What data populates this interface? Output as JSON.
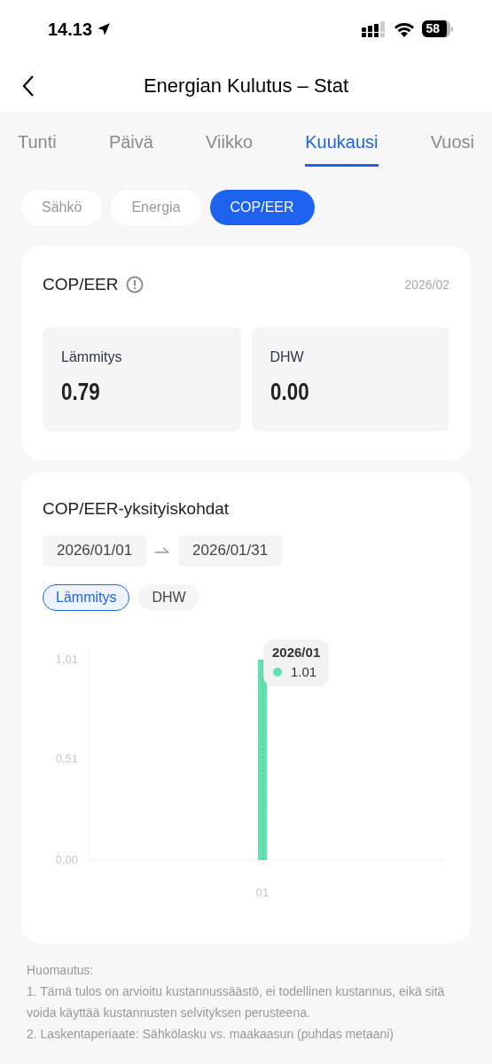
{
  "status_bar": {
    "time": "14.13",
    "battery": "58"
  },
  "header": {
    "title": "Energian Kulutus – Stat"
  },
  "tabs": [
    {
      "label": "Tunti",
      "selected": false
    },
    {
      "label": "Päivä",
      "selected": false
    },
    {
      "label": "Viikko",
      "selected": false
    },
    {
      "label": "Kuukausi",
      "selected": true
    },
    {
      "label": "Vuosi",
      "selected": false
    }
  ],
  "segments": [
    {
      "label": "Sähkö",
      "selected": false
    },
    {
      "label": "Energia",
      "selected": false
    },
    {
      "label": "COP/EER",
      "selected": true
    }
  ],
  "summary": {
    "title": "COP/EER",
    "period": "2026/02",
    "stats": [
      {
        "label": "Lämmitys",
        "value": "0.79"
      },
      {
        "label": "DHW",
        "value": "0.00"
      }
    ]
  },
  "details": {
    "title": "COP/EER-yksityiskohdat",
    "start_date": "2026/01/01",
    "end_date": "2026/01/31",
    "filters": [
      {
        "label": "Lämmitys",
        "selected": true
      },
      {
        "label": "DHW",
        "selected": false
      }
    ],
    "tooltip": {
      "title": "2026/01",
      "value": "1.01",
      "color": "#5ce5b1"
    },
    "chart_data": {
      "type": "bar",
      "categories": [
        "01"
      ],
      "series": [
        {
          "color": "#5ce5b1",
          "values": [
            1.01
          ]
        }
      ],
      "ylim": [
        0,
        1.01
      ],
      "yticks": [
        {
          "value": 0,
          "label": "0,00"
        },
        {
          "value": 0.51,
          "label": "0,51"
        },
        {
          "value": 1.01,
          "label": "1,01"
        }
      ]
    }
  },
  "notes": {
    "title": "Huomautus:",
    "lines": [
      "1. Tämä tulos on arvioitu kustannussäästö, ei todellinen kustannus, eikä sitä voida käyttää kustannusten selvityksen perusteena.",
      "2. Laskentaperiaate: Sähkölasku vs. maakaasun (puhdas metaani)"
    ]
  }
}
